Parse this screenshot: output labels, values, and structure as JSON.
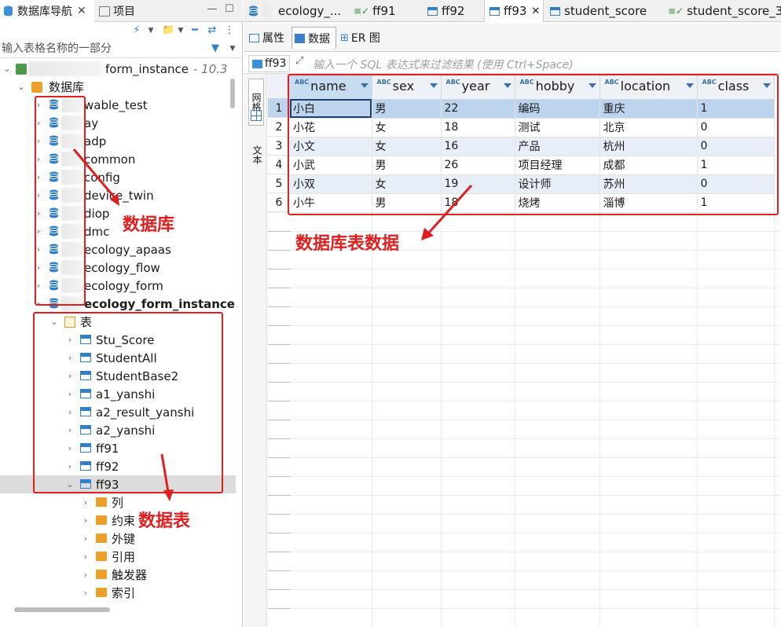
{
  "left_panel": {
    "tabs": [
      {
        "label": "数据库导航"
      },
      {
        "label": "项目"
      }
    ],
    "filter_placeholder": "输入表格名称的一部分",
    "connection": {
      "label": "form_instance",
      "suffix": "- 10.3"
    },
    "db_folder_label": "数据库",
    "databases": [
      "wable_test",
      "ay",
      "adp",
      "common",
      "config",
      "device_twin",
      "diop",
      "dmc",
      "ecology_apaas",
      "ecology_flow",
      "ecology_form",
      "ecology_form_instance"
    ],
    "tables_folder_label": "表",
    "tables": [
      "Stu_Score",
      "StudentAll",
      "StudentBase2",
      "a1_yanshi",
      "a2_result_yanshi",
      "a2_yanshi",
      "ff91",
      "ff92",
      "ff93"
    ],
    "ff93_children": [
      "列",
      "约束",
      "外键",
      "引用",
      "触发器",
      "索引"
    ]
  },
  "annotations": {
    "databases": "数据库",
    "tables": "数据表",
    "table_data": "数据库表数据"
  },
  "editor_tabs": [
    {
      "label": "ecology_..."
    },
    {
      "label": "ff91"
    },
    {
      "label": "ff92"
    },
    {
      "label": "ff93"
    },
    {
      "label": "student_score"
    },
    {
      "label": "student_score_3"
    }
  ],
  "sub_tabs": [
    {
      "label": "属性"
    },
    {
      "label": "数据"
    },
    {
      "label": "ER 图"
    }
  ],
  "filter_bar": {
    "table_label": "ff93",
    "placeholder": "输入一个 SQL 表达式来过滤结果 (使用 Ctrl+Space)"
  },
  "side_tabs": {
    "grid": "网格",
    "text": "文本"
  },
  "grid": {
    "columns": [
      "name",
      "sex",
      "year",
      "hobby",
      "location",
      "class"
    ],
    "rows": [
      [
        "小白",
        "男",
        "22",
        "编码",
        "重庆",
        "1"
      ],
      [
        "小花",
        "女",
        "18",
        "测试",
        "北京",
        "0"
      ],
      [
        "小文",
        "女",
        "16",
        "产品",
        "杭州",
        "0"
      ],
      [
        "小武",
        "男",
        "26",
        "项目经理",
        "成都",
        "1"
      ],
      [
        "小双",
        "女",
        "19",
        "设计师",
        "苏州",
        "0"
      ],
      [
        "小牛",
        "男",
        "18",
        "烧烤",
        "淄博",
        "1"
      ]
    ],
    "row_numbers": [
      "1",
      "2",
      "3",
      "4",
      "5",
      "6"
    ]
  },
  "colors": {
    "accent": "#e0201f",
    "selection": "#bcd4ee",
    "header": "#eef2f7"
  }
}
